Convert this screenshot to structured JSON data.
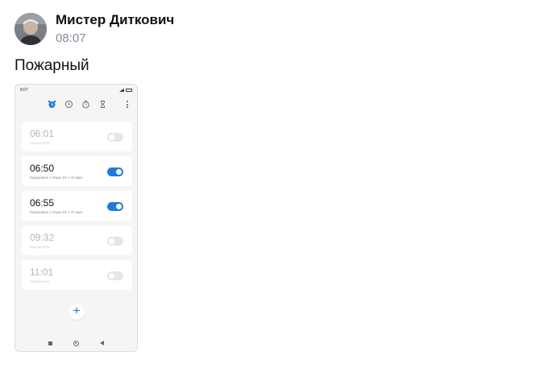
{
  "post": {
    "author": "Мистер Диткович",
    "time": "08:07",
    "text": "Пожарный"
  },
  "screenshot": {
    "status_time": "8:07",
    "toolbar_icons": [
      "alarm-icon",
      "clock-icon",
      "stopwatch-icon",
      "timer-icon",
      "more-icon"
    ],
    "alarms": [
      {
        "time": "06:01",
        "subtitle": "Однократно",
        "enabled": false
      },
      {
        "time": "06:50",
        "subtitle": "Ежедневно | Через 22 ч 42 мин",
        "enabled": true
      },
      {
        "time": "06:55",
        "subtitle": "Ежедневно | Через 22 ч 47 мин",
        "enabled": true
      },
      {
        "time": "09:32",
        "subtitle": "Однократно",
        "enabled": false
      },
      {
        "time": "11:01",
        "subtitle": "Однократно",
        "enabled": false
      }
    ],
    "add_label": "+"
  },
  "colors": {
    "accent": "#1f7ae0",
    "secondary_text": "#818c99"
  }
}
